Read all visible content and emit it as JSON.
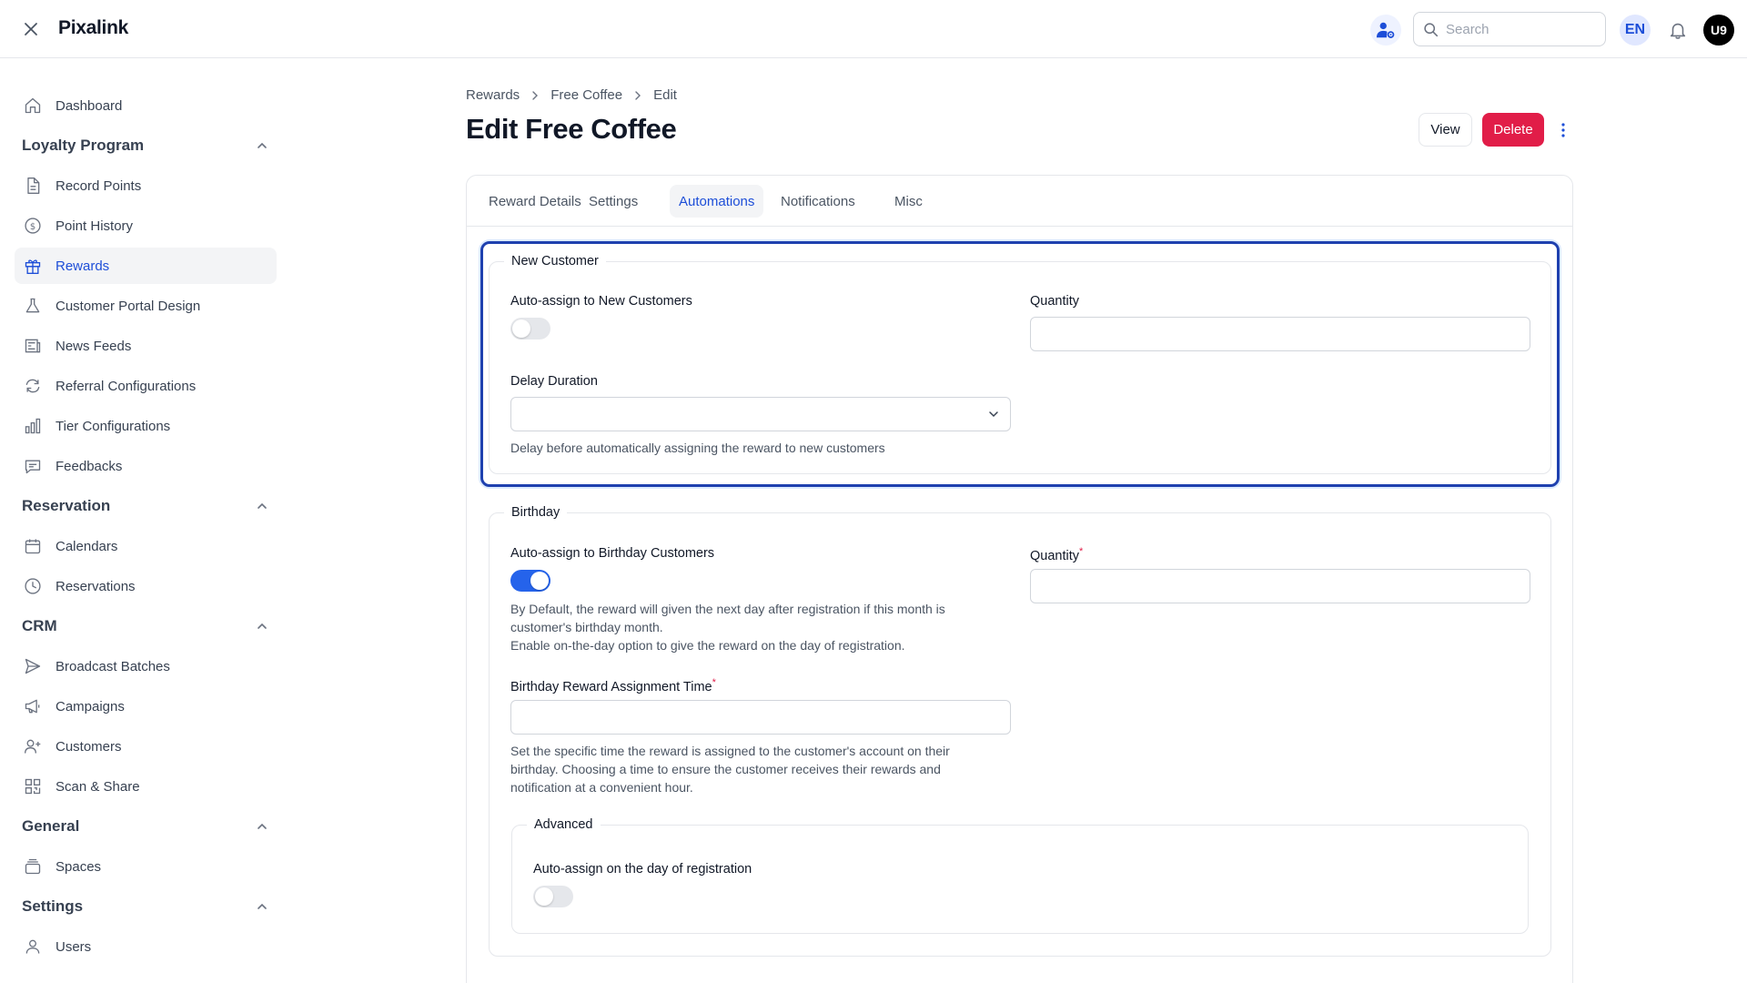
{
  "app": {
    "brand": "Pixalink"
  },
  "topbar": {
    "search_placeholder": "Search",
    "lang": "EN",
    "avatar": "U9"
  },
  "sidebar": {
    "dashboard": "Dashboard",
    "groups": {
      "loyalty": "Loyalty Program",
      "reservation": "Reservation",
      "crm": "CRM",
      "general": "General",
      "settings": "Settings"
    },
    "items": {
      "record_points": "Record Points",
      "point_history": "Point History",
      "rewards": "Rewards",
      "customer_portal_design": "Customer Portal Design",
      "news_feeds": "News Feeds",
      "referral_configurations": "Referral Configurations",
      "tier_configurations": "Tier Configurations",
      "feedbacks": "Feedbacks",
      "calendars": "Calendars",
      "reservations": "Reservations",
      "broadcast_batches": "Broadcast Batches",
      "campaigns": "Campaigns",
      "customers": "Customers",
      "scan_share": "Scan & Share",
      "spaces": "Spaces",
      "users": "Users"
    }
  },
  "breadcrumb": {
    "root": "Rewards",
    "item": "Free Coffee",
    "current": "Edit"
  },
  "page": {
    "title": "Edit Free Coffee",
    "view_label": "View",
    "delete_label": "Delete"
  },
  "tabs": {
    "reward_details": "Reward Details",
    "settings": "Settings",
    "automations": "Automations",
    "notifications": "Notifications",
    "misc": "Misc"
  },
  "new_customer": {
    "legend": "New Customer",
    "auto_assign_label": "Auto-assign to New Customers",
    "auto_assign_on": false,
    "quantity_label": "Quantity",
    "quantity_value": "",
    "delay_label": "Delay Duration",
    "delay_value": "",
    "delay_hint": "Delay before automatically assigning the reward to new customers"
  },
  "birthday": {
    "legend": "Birthday",
    "auto_assign_label": "Auto-assign to Birthday Customers",
    "auto_assign_on": true,
    "hint_line1": "By Default, the reward will given the next day after registration if this month is",
    "hint_line2": "customer's birthday month.",
    "hint_line3": "Enable on-the-day option to give the reward on the day of registration.",
    "quantity_label": "Quantity",
    "quantity_required": "*",
    "quantity_value": "",
    "time_label": "Birthday Reward Assignment Time",
    "time_required": "*",
    "time_value": "",
    "time_hint_line1": "Set the specific time the reward is assigned to the customer's account on their",
    "time_hint_line2": "birthday. Choosing a time to ensure the customer receives their rewards and",
    "time_hint_line3": "notification at a convenient hour.",
    "advanced": {
      "legend": "Advanced",
      "day_of_reg_label": "Auto-assign on the day of registration",
      "day_of_reg_on": false
    }
  },
  "colors": {
    "accent": "#1d4ed8",
    "danger": "#e11d48",
    "toggle_on": "#2563eb",
    "focus_ring": "#1e40af"
  },
  "icons": {
    "close": "close-icon",
    "tenant": "user-gear-icon",
    "search": "search-icon",
    "bell": "bell-icon",
    "more": "more-vertical-icon"
  }
}
